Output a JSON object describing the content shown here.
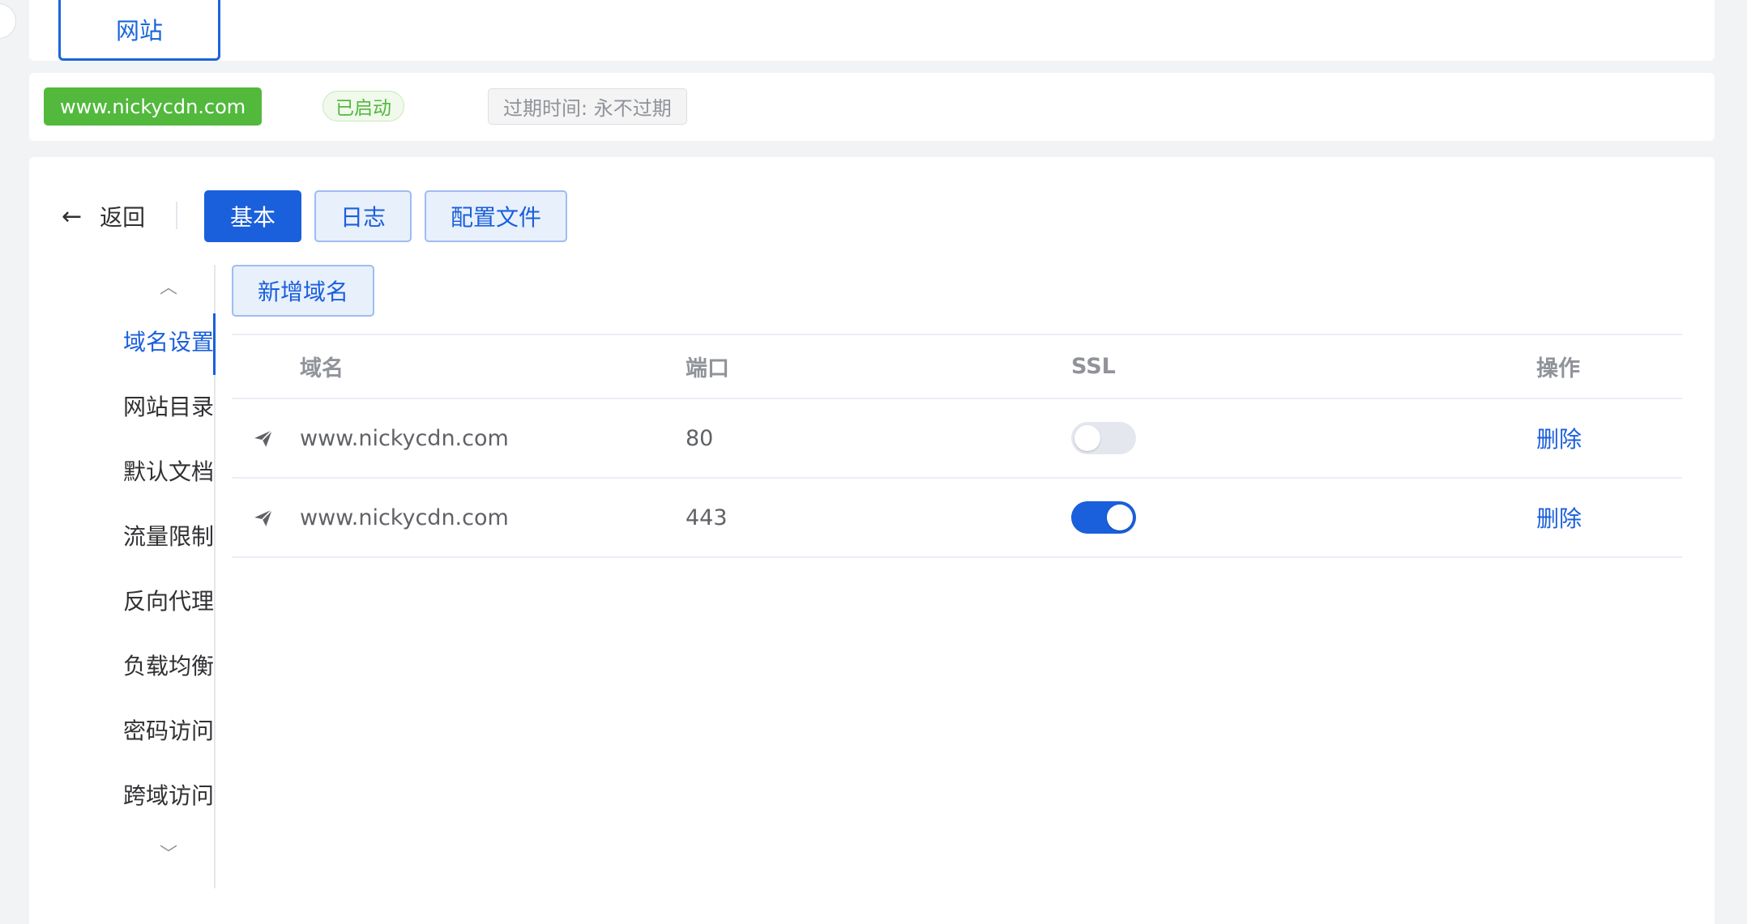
{
  "top": {
    "tab_label": "网站"
  },
  "info": {
    "site_name": "www.nickycdn.com",
    "status": "已启动",
    "expire": "过期时间: 永不过期"
  },
  "toolbar": {
    "back_label": "返回",
    "tabs": [
      {
        "label": "基本",
        "active": true
      },
      {
        "label": "日志",
        "active": false
      },
      {
        "label": "配置文件",
        "active": false
      }
    ]
  },
  "side_menu": {
    "items": [
      {
        "label": "域名设置",
        "active": true
      },
      {
        "label": "网站目录"
      },
      {
        "label": "默认文档"
      },
      {
        "label": "流量限制"
      },
      {
        "label": "反向代理"
      },
      {
        "label": "负载均衡"
      },
      {
        "label": "密码访问"
      },
      {
        "label": "跨域访问"
      }
    ]
  },
  "domains": {
    "add_label": "新增域名",
    "columns": {
      "domain": "域名",
      "port": "端口",
      "ssl": "SSL",
      "op": "操作"
    },
    "rows": [
      {
        "domain": "www.nickycdn.com",
        "port": "80",
        "ssl": false,
        "op": "删除"
      },
      {
        "domain": "www.nickycdn.com",
        "port": "443",
        "ssl": true,
        "op": "删除"
      }
    ]
  },
  "colors": {
    "primary": "#1a5fdc",
    "success": "#52b93d"
  }
}
